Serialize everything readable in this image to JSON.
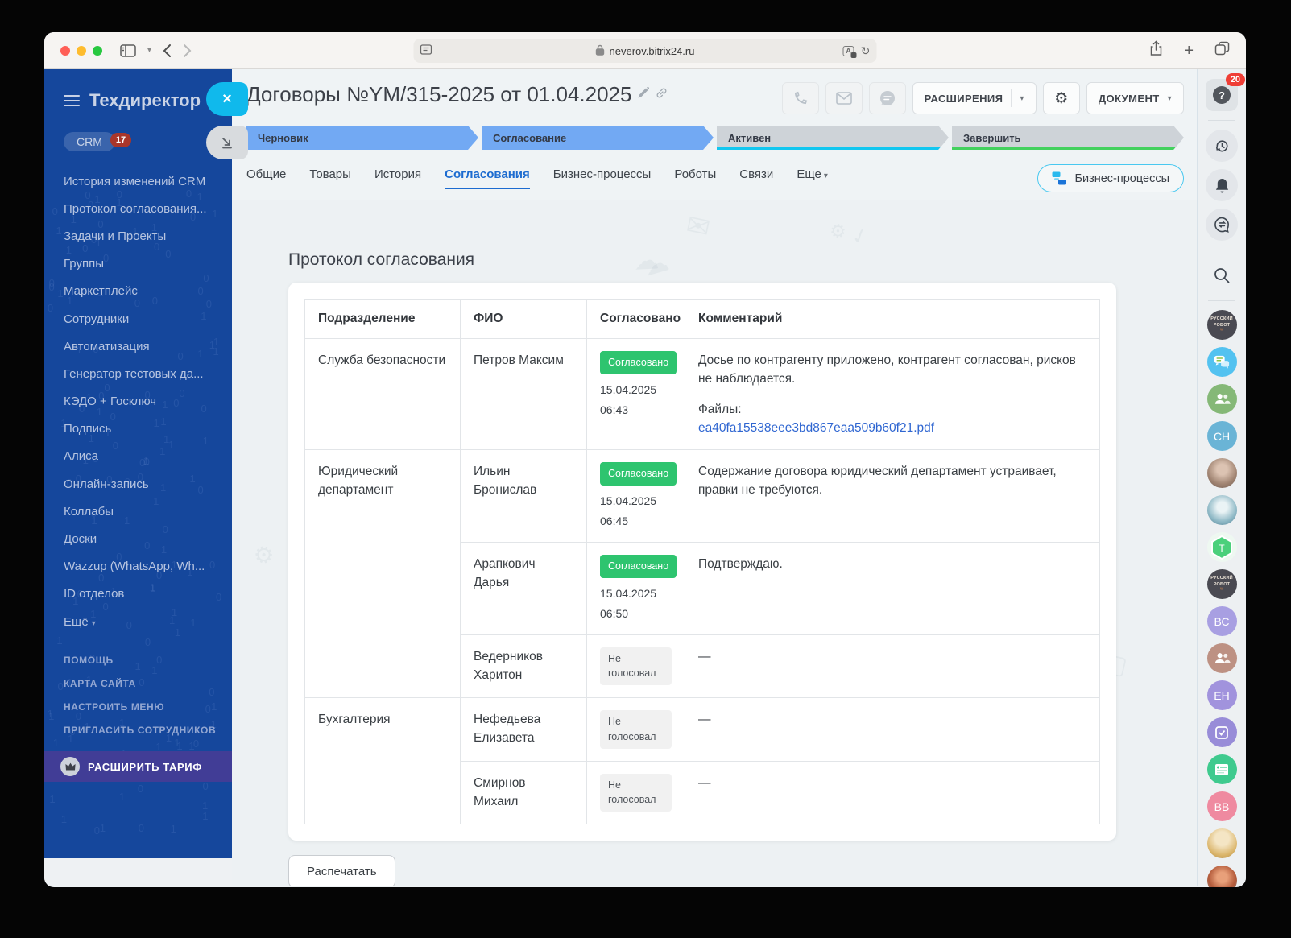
{
  "browser": {
    "url": "neverov.bitrix24.ru"
  },
  "sidebar": {
    "title": "Техдиректор",
    "crm_label": "CRM",
    "crm_count": "17",
    "items": [
      "История изменений CRM",
      "Протокол согласования...",
      "Задачи и Проекты",
      "Группы",
      "Маркетплейс",
      "Сотрудники",
      "Автоматизация",
      "Генератор тестовых да...",
      "КЭДО + Госключ",
      "Подпись",
      "Алиса",
      "Онлайн-запись",
      "Коллабы",
      "Доски",
      "Wazzup (WhatsApp, Wh...",
      "ID отделов",
      "Ещё"
    ],
    "footer_items": [
      "ПОМОЩЬ",
      "КАРТА САЙТА",
      "НАСТРОИТЬ МЕНЮ",
      "ПРИГЛАСИТЬ СОТРУДНИКОВ"
    ],
    "upgrade_label": "РАСШИРИТЬ ТАРИФ"
  },
  "header": {
    "title": "Договоры №YM/315-2025 от 01.04.2025",
    "extensions_label": "РАСШИРЕНИЯ",
    "document_label": "ДОКУМЕНТ"
  },
  "stages": [
    {
      "label": "Черновик",
      "style": "blue",
      "stripe": ""
    },
    {
      "label": "Согласование",
      "style": "blue",
      "stripe": ""
    },
    {
      "label": "Активен",
      "style": "gray",
      "stripe": "#12c7f0"
    },
    {
      "label": "Завершить",
      "style": "gray",
      "stripe": "#43d15e"
    }
  ],
  "tabs": [
    {
      "label": "Общие",
      "active": false,
      "caret": false
    },
    {
      "label": "Товары",
      "active": false,
      "caret": false
    },
    {
      "label": "История",
      "active": false,
      "caret": false
    },
    {
      "label": "Согласования",
      "active": true,
      "caret": false
    },
    {
      "label": "Бизнес-процессы",
      "active": false,
      "caret": false
    },
    {
      "label": "Роботы",
      "active": false,
      "caret": false
    },
    {
      "label": "Связи",
      "active": false,
      "caret": false
    },
    {
      "label": "Еще",
      "active": false,
      "caret": true
    }
  ],
  "bp_button_label": "Бизнес-процессы",
  "main": {
    "section_title": "Протокол согласования",
    "print_button": "Распечатать",
    "table": {
      "headers": [
        "Подразделение",
        "ФИО",
        "Согласовано",
        "Комментарий"
      ],
      "groups": [
        {
          "department": "Служба безопасности",
          "rows": [
            {
              "name": "Петров Максим",
              "status": "Согласовано",
              "status_type": "approved",
              "date": "15.04.2025",
              "time": "06:43",
              "comment": "Досье по контрагенту приложено, контрагент согласован, рисков не наблюдается.",
              "files_label": "Файлы:",
              "file_link": "ea40fa15538eee3bd867eaa509b60f21.pdf"
            }
          ]
        },
        {
          "department": "Юридический департамент",
          "rows": [
            {
              "name": "Ильин Бронислав",
              "status": "Согласовано",
              "status_type": "approved",
              "date": "15.04.2025",
              "time": "06:45",
              "comment": "Содержание договора юридический департамент устраивает, правки не требуются."
            },
            {
              "name": "Арапкович Дарья",
              "status": "Согласовано",
              "status_type": "approved",
              "date": "15.04.2025",
              "time": "06:50",
              "comment": "Подтверждаю."
            },
            {
              "name": "Ведерников Харитон",
              "status": "Не голосовал",
              "status_type": "none",
              "comment": "—"
            }
          ]
        },
        {
          "department": "Бухгалтерия",
          "rows": [
            {
              "name": "Нефедьева Елизавета",
              "status": "Не голосовал",
              "status_type": "none",
              "comment": "—"
            },
            {
              "name": "Смирнов Михаил",
              "status": "Не голосовал",
              "status_type": "none",
              "comment": "—"
            }
          ]
        }
      ]
    }
  },
  "right_rail": {
    "help_badge": "20",
    "items": [
      {
        "type": "help",
        "name": "help-button",
        "badge": "20"
      },
      {
        "type": "divider"
      },
      {
        "type": "icon",
        "name": "history-icon"
      },
      {
        "type": "icon",
        "name": "notifications-bell-icon"
      },
      {
        "type": "icon",
        "name": "messenger-icon"
      },
      {
        "type": "divider"
      },
      {
        "type": "icon",
        "name": "search-icon",
        "bare": true
      },
      {
        "type": "divider"
      },
      {
        "type": "avatar",
        "kind": "logo",
        "name": "avatar-russian-robot",
        "label1": "РУССКИЙ",
        "label2": "РОБОТ",
        "bg": "#4a4a52"
      },
      {
        "type": "avatar",
        "kind": "chat-bubbles",
        "name": "avatar-chat-app",
        "bg": "#53c2f0"
      },
      {
        "type": "avatar",
        "kind": "people",
        "name": "avatar-group-green",
        "bg": "#85b877"
      },
      {
        "type": "avatar",
        "kind": "initials",
        "name": "avatar-ch",
        "label": "СН",
        "bg": "#6ab4d6"
      },
      {
        "type": "avatar",
        "kind": "photo-person",
        "name": "avatar-photo-person"
      },
      {
        "type": "avatar",
        "kind": "photo-cat",
        "name": "avatar-cat"
      },
      {
        "type": "avatar",
        "kind": "hex",
        "name": "avatar-t-hexagon",
        "label": "T",
        "bg": "#4bd07b"
      },
      {
        "type": "avatar",
        "kind": "logo",
        "name": "avatar-russian-robot-2",
        "label1": "РУССКИЙ",
        "label2": "РОБОТ",
        "bg": "#4a4a52"
      },
      {
        "type": "avatar",
        "kind": "initials",
        "name": "avatar-bc",
        "label": "ВС",
        "bg": "#a89fe2"
      },
      {
        "type": "avatar",
        "kind": "people",
        "name": "avatar-group-brown",
        "bg": "#bd9183"
      },
      {
        "type": "avatar",
        "kind": "initials",
        "name": "avatar-eh",
        "label": "ЕН",
        "bg": "#a193dd"
      },
      {
        "type": "avatar",
        "kind": "task",
        "name": "avatar-tasks",
        "bg": "#988cd8"
      },
      {
        "type": "avatar",
        "kind": "news",
        "name": "avatar-news",
        "bg": "#3fca8e"
      },
      {
        "type": "avatar",
        "kind": "initials",
        "name": "avatar-bb",
        "label": "ВВ",
        "bg": "#ef8aa0"
      },
      {
        "type": "avatar",
        "kind": "photo-blonde",
        "name": "avatar-blonde"
      },
      {
        "type": "avatar",
        "kind": "photo-redhead",
        "name": "avatar-redhead"
      }
    ]
  },
  "colors": {
    "sidebar_bg": "#15479c",
    "upgrade_bg": "#413d96",
    "stage_blue": "#72a9f3",
    "stage_gray": "#ced3d8",
    "stripe_cyan": "#12c7f0",
    "stripe_green": "#43d15e",
    "badge_approved": "#2ec46f",
    "active_tab": "#1c6bd0",
    "link": "#2f66d1",
    "close_button": "#10b9ec",
    "help_badge_bg": "#ef3e36"
  }
}
